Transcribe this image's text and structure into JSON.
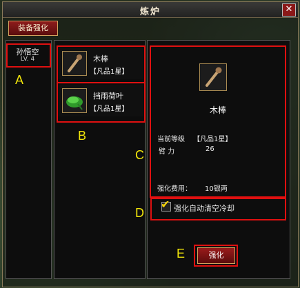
{
  "window": {
    "title": "炼炉",
    "close_glyph": "✕"
  },
  "tabs": [
    {
      "label": "装备强化"
    }
  ],
  "character": {
    "name": "孙悟空",
    "level": "LV. 4"
  },
  "items": [
    {
      "name": "木棒",
      "grade": "【凡品1星】",
      "icon": "wooden-staff-icon"
    },
    {
      "name": "挡雨荷叶",
      "grade": "【凡品1星】",
      "icon": "lotus-leaf-icon"
    }
  ],
  "detail": {
    "item_name": "木棒",
    "current_level_label": "当前等级",
    "current_level_value": "【凡品1星】",
    "stat_label": "臂 力",
    "stat_value": "26",
    "cost_label": "强化费用：",
    "cost_value": "10银两"
  },
  "auto_cooldown": {
    "label": "强化自动清空冷却",
    "checked": true
  },
  "enhance_button": {
    "label": "强化"
  },
  "markers": {
    "A": "A",
    "B": "B",
    "C": "C",
    "D": "D",
    "E": "E"
  }
}
